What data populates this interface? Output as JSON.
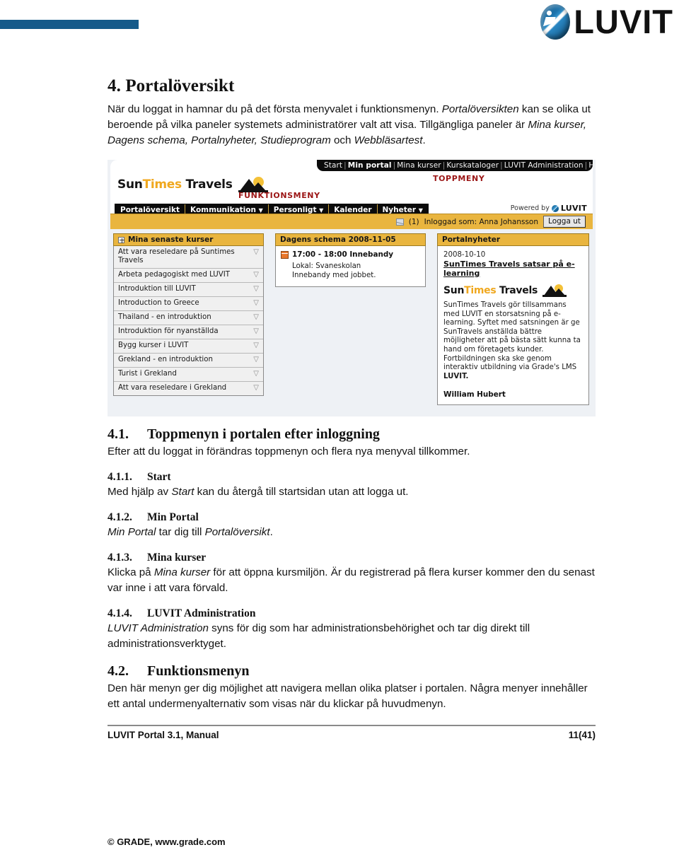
{
  "header": {
    "brand_text": "LUVIT",
    "rule_color": "#155a8a"
  },
  "document": {
    "section4": {
      "number": "4.",
      "title": "Portalöversikt",
      "intro_1": "När du loggat in hamnar du på det första menyvalet i funktionsmenyn. ",
      "intro_em1": "Portalöversikten",
      "intro_2": " kan se olika ut beroende på vilka paneler systemets administratörer valt att visa.  Tillgängliga paneler är ",
      "intro_em2": "Mina kurser, Dagens schema, Portalnyheter, Studieprogram",
      "intro_3": " och ",
      "intro_em3": "Webbläsartest",
      "intro_4": "."
    },
    "section41": {
      "number": "4.1.",
      "title": "Toppmenyn i portalen efter inloggning",
      "body": "Efter att du loggat in förändras toppmenyn och flera nya menyval tillkommer."
    },
    "section411": {
      "number": "4.1.1.",
      "title": "Start",
      "body_1": "Med hjälp av ",
      "body_em": "Start",
      "body_2": " kan du återgå till startsidan utan att logga ut."
    },
    "section412": {
      "number": "4.1.2.",
      "title": "Min Portal",
      "body_em1": "Min Portal",
      "body_1": " tar dig till ",
      "body_em2": "Portalöversikt",
      "body_2": "."
    },
    "section413": {
      "number": "4.1.3.",
      "title": "Mina kurser",
      "body_1": "Klicka på ",
      "body_em": "Mina kurser",
      "body_2": " för att öppna kursmiljön. Är du registrerad på flera kurser kommer den du senast var inne i att vara förvald."
    },
    "section414": {
      "number": "4.1.4.",
      "title": "LUVIT Administration",
      "body_em": "LUVIT Administration",
      "body_1": " syns för dig som har administrationsbehörighet och tar dig direkt till administrationsverktyget."
    },
    "section42": {
      "number": "4.2.",
      "title": "Funktionsmenyn",
      "body": "Den här menyn ger dig möjlighet att navigera mellan olika platser i portalen. Några menyer innehåller ett antal undermenyalternativ som visas när du klickar på huvudmenyn."
    }
  },
  "footer": {
    "left": "LUVIT Portal 3.1, Manual",
    "right": "11(41)",
    "copyright": "© GRADE, www.grade.com"
  },
  "screenshot": {
    "topmenu": {
      "items": [
        "Start",
        "Min portal",
        "Mina kurser",
        "Kurskataloger",
        "LUVIT Administration",
        "Hjälp"
      ],
      "active": "Min portal"
    },
    "annotations": {
      "topmeny": "TOPPMENY",
      "funktionsmeny": "FUNKTIONSMENY"
    },
    "site_logo": {
      "part1": "Sun",
      "part2": "Times",
      "part3": "Travels"
    },
    "funcmenu": {
      "items": [
        {
          "label": "Portalöversikt",
          "caret": false
        },
        {
          "label": "Kommunikation",
          "caret": true
        },
        {
          "label": "Personligt",
          "caret": true
        },
        {
          "label": "Kalender",
          "caret": false
        },
        {
          "label": "Nyheter",
          "caret": true
        }
      ]
    },
    "powered_by": {
      "prefix": "Powered by",
      "brand": "LUVIT"
    },
    "loginbar": {
      "mail_count": "(1)",
      "logged_in_as": "Inloggad som: Anna Johansson",
      "logout_label": "Logga ut"
    },
    "panel_courses": {
      "title": "Mina senaste kurser",
      "items": [
        "Att vara reseledare på Suntimes Travels",
        "Arbeta pedagogiskt med LUVIT",
        "Introduktion till LUVIT",
        "Introduction to Greece",
        "Thailand - en introduktion",
        "Introduktion för nyanställda",
        "Bygg kurser i LUVIT",
        "Grekland - en introduktion",
        "Turist i Grekland",
        "Att vara reseledare i Grekland"
      ]
    },
    "panel_schedule": {
      "title": "Dagens schema 2008-11-05",
      "event_title": "17:00 - 18:00 Innebandy",
      "event_location": "Lokal: Svaneskolan",
      "event_note": "Innebandy med jobbet."
    },
    "panel_news": {
      "title": "Portalnyheter",
      "date": "2008-10-10",
      "headline": "SunTimes Travels satsar på e-learning",
      "logo_part1": "Sun",
      "logo_part2": "Times",
      "logo_part3": "Travels",
      "body": "SunTimes Travels gör tillsammans med LUVIT en storsatsning på e-learning. Syftet med satsningen är ge SunTravels anställda bättre möjligheter att på bästa sätt kunna ta hand om företagets kunder. Fortbildningen ska ske genom interaktiv utbildning via Grade's LMS ",
      "body_bold": "LUVIT.",
      "author": "William Hubert"
    }
  }
}
